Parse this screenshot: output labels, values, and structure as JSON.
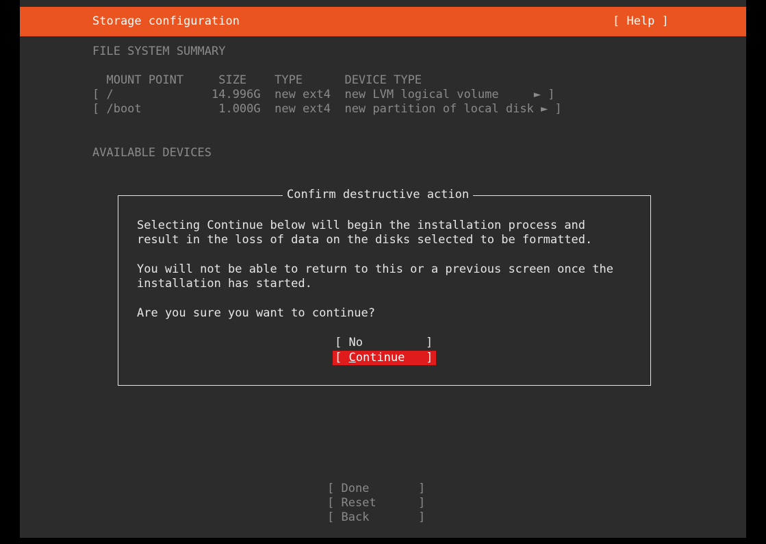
{
  "header": {
    "title": "Storage configuration",
    "help_label": "[ Help ]",
    "bg_color": "#e95420"
  },
  "filesystem_summary": {
    "heading": "FILE SYSTEM SUMMARY",
    "columns": [
      "MOUNT POINT",
      "SIZE",
      "TYPE",
      "DEVICE TYPE"
    ],
    "column_header_line": "  MOUNT POINT     SIZE    TYPE      DEVICE TYPE",
    "rows": [
      {
        "mount_point": "/",
        "size": "14.996G",
        "type": "new ext4",
        "device_type": "new LVM logical volume",
        "line": "[ /              14.996G  new ext4  new LVM logical volume     ► ]"
      },
      {
        "mount_point": "/boot",
        "size": "1.000G",
        "type": "new ext4",
        "device_type": "new partition of local disk",
        "line": "[ /boot           1.000G  new ext4  new partition of local disk ► ]"
      }
    ]
  },
  "available_devices": {
    "heading": "AVAILABLE DEVICES"
  },
  "dialog": {
    "title": "Confirm destructive action",
    "line1": "Selecting Continue below will begin the installation process and",
    "line2": "result in the loss of data on the disks selected to be formatted.",
    "line3": "You will not be able to return to this or a previous screen once the",
    "line4": "installation has started.",
    "question": "Are you sure you want to continue?",
    "no_label": "[ No         ]",
    "continue_label_prefix": "[ ",
    "continue_label_hotkey": "C",
    "continue_label_rest": "ontinue   ]",
    "highlight_color": "#e01b1b"
  },
  "footer": {
    "done_label": "[ Done       ]",
    "reset_label": "[ Reset      ]",
    "back_label": "[ Back       ]"
  }
}
